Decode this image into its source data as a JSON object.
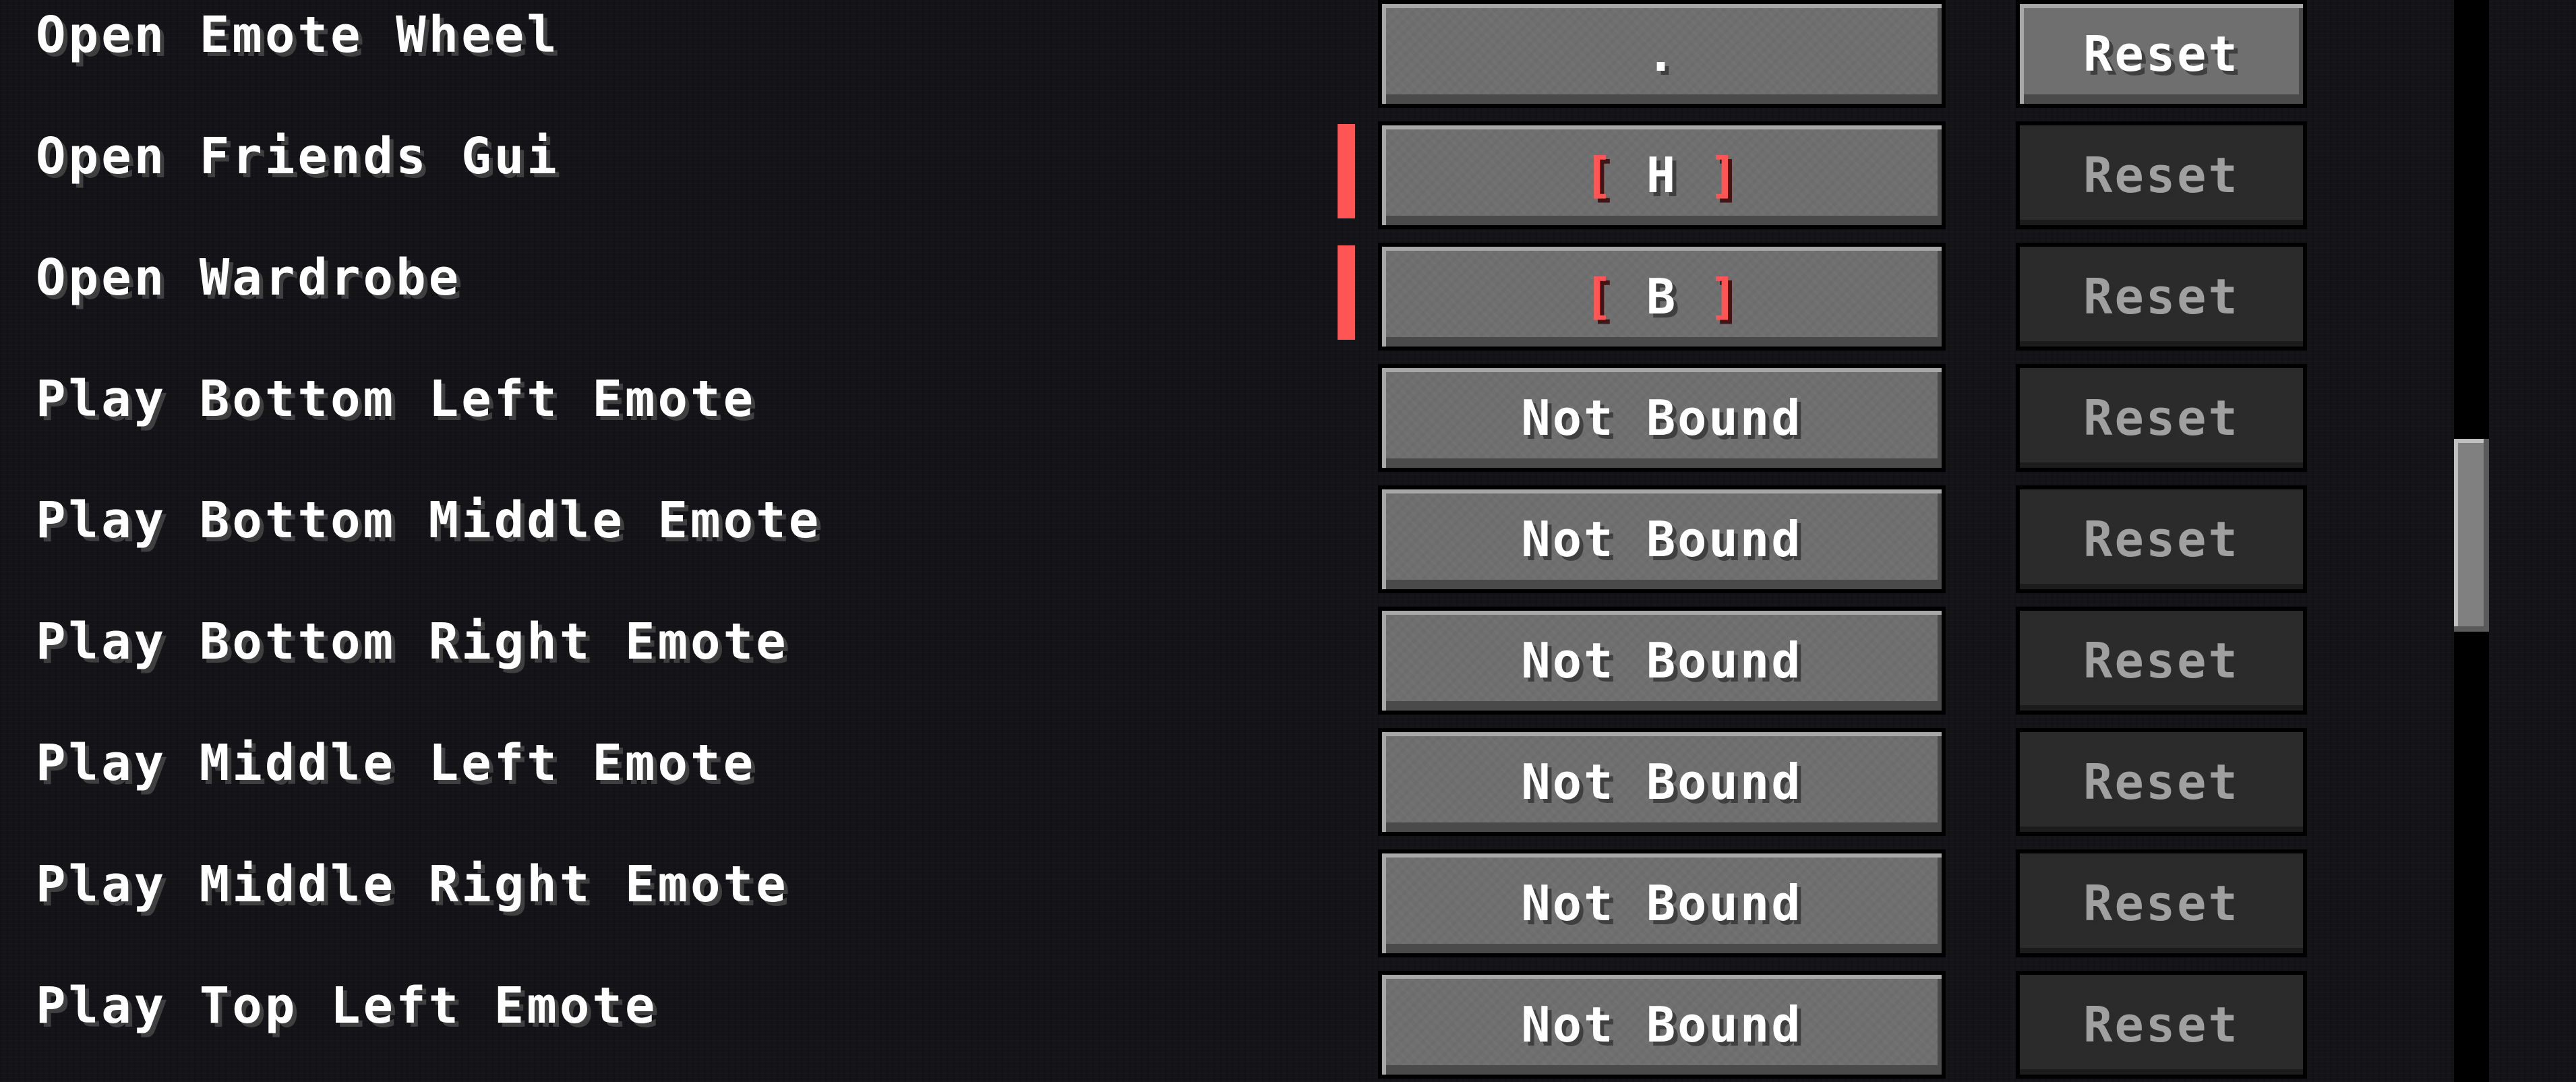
{
  "keybinds": [
    {
      "label": "Open Emote Wheel",
      "key": ".",
      "conflict": false,
      "reset_label": "Reset",
      "reset_enabled": true
    },
    {
      "label": "Open Friends Gui",
      "key": "H",
      "bracket_open": "[",
      "bracket_close": "]",
      "conflict": true,
      "reset_label": "Reset",
      "reset_enabled": false
    },
    {
      "label": "Open Wardrobe",
      "key": "B",
      "bracket_open": "[",
      "bracket_close": "]",
      "conflict": true,
      "reset_label": "Reset",
      "reset_enabled": false
    },
    {
      "label": "Play Bottom Left Emote",
      "key": "Not Bound",
      "conflict": false,
      "reset_label": "Reset",
      "reset_enabled": false
    },
    {
      "label": "Play Bottom Middle Emote",
      "key": "Not Bound",
      "conflict": false,
      "reset_label": "Reset",
      "reset_enabled": false
    },
    {
      "label": "Play Bottom Right Emote",
      "key": "Not Bound",
      "conflict": false,
      "reset_label": "Reset",
      "reset_enabled": false
    },
    {
      "label": "Play Middle Left Emote",
      "key": "Not Bound",
      "conflict": false,
      "reset_label": "Reset",
      "reset_enabled": false
    },
    {
      "label": "Play Middle Right Emote",
      "key": "Not Bound",
      "conflict": false,
      "reset_label": "Reset",
      "reset_enabled": false
    },
    {
      "label": "Play Top Left Emote",
      "key": "Not Bound",
      "conflict": false,
      "reset_label": "Reset",
      "reset_enabled": false
    }
  ],
  "colors": {
    "background": "#131318",
    "button_face": "#6f6f6f",
    "button_disabled": "#2b2b2b",
    "conflict": "#ff5555",
    "text": "#ffffff",
    "text_disabled": "#a0a0a0"
  },
  "scrollbar": {
    "position_fraction": 0.46
  }
}
